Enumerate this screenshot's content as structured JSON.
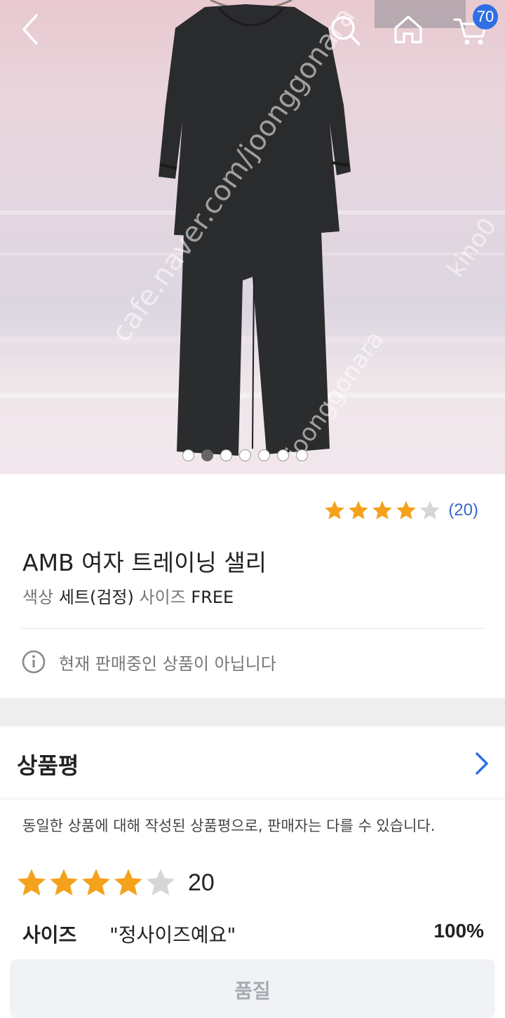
{
  "header": {
    "back_icon": "back-arrow-icon",
    "search_icon": "search-icon",
    "home_icon": "home-icon",
    "cart_icon": "cart-icon",
    "cart_count": "70"
  },
  "hero": {
    "watermark_main": "cafe.naver.com/joonggonara",
    "watermark_side": "kino0",
    "watermark_low": "joonggonara",
    "slides_total": 7,
    "slide_active_index": 1
  },
  "product": {
    "rating_stars": 4,
    "rating_max": 5,
    "review_count_label": "(20)",
    "title": "AMB 여자 트레이닝 샐리",
    "color_label": "색상",
    "color_value": "세트(검정)",
    "size_label": "사이즈",
    "size_value": "FREE",
    "notice_icon": "info-icon",
    "notice_text": "현재 판매중인 상품이 아닙니다"
  },
  "reviews": {
    "section_title": "상품평",
    "chevron_icon": "chevron-right-icon",
    "note": "동일한 상품에 대해 작성된 상품평으로, 판매자는 다를 수 있습니다.",
    "rating_stars": 4,
    "rating_max": 5,
    "count": "20",
    "size_title": "사이즈",
    "size_answer": "\"정사이즈예요\"",
    "size_percent": "100%",
    "quality_label": "품질"
  },
  "colors": {
    "star_filled": "#f4a21c",
    "star_empty": "#d6d6d6",
    "accent_blue": "#3a66c9",
    "badge_blue": "#2f6fe5"
  }
}
